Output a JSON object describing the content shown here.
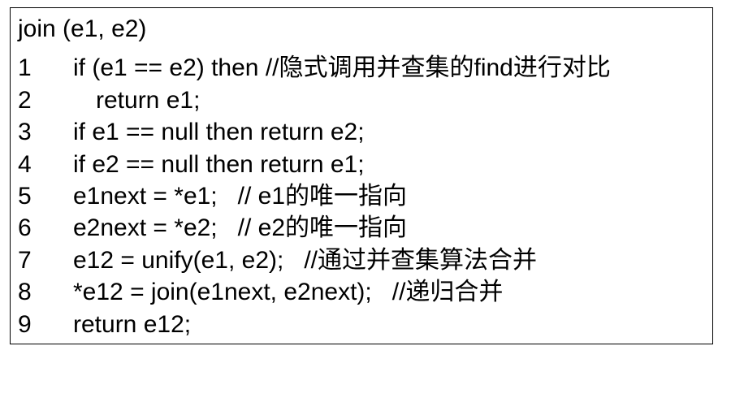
{
  "header": "join (e1, e2)",
  "lines": [
    {
      "num": "1",
      "code": "if (e1 == e2) then //隐式调用并查集的find进行对比",
      "indent": 0
    },
    {
      "num": "2",
      "code": "return e1;",
      "indent": 1
    },
    {
      "num": "3",
      "code": "if e1 == null then return e2;",
      "indent": 0
    },
    {
      "num": "4",
      "code": "if e2 == null then return e1;",
      "indent": 0
    },
    {
      "num": "5",
      "code": "e1next = *e1;   // e1的唯一指向",
      "indent": 0
    },
    {
      "num": "6",
      "code": "e2next = *e2;   // e2的唯一指向",
      "indent": 0
    },
    {
      "num": "7",
      "code": "e12 = unify(e1, e2);   //通过并查集算法合并",
      "indent": 0
    },
    {
      "num": "8",
      "code": "*e12 = join(e1next, e2next);   //递归合并",
      "indent": 0
    },
    {
      "num": "9",
      "code": "return e12;",
      "indent": 0
    }
  ]
}
